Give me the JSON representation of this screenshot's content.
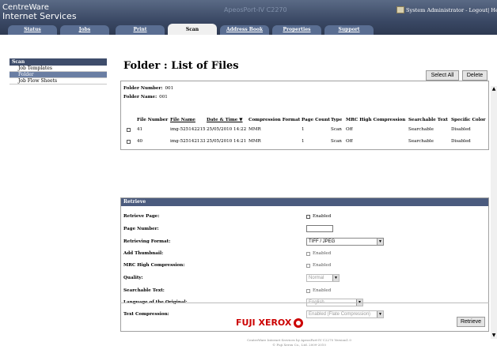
{
  "header": {
    "brand_line1": "CentreWare",
    "brand_line2": "Internet Services",
    "model": "ApeosPort-IV C2270",
    "user_text": "System Administrator - Logout| Help"
  },
  "tabs": [
    {
      "label": "Status"
    },
    {
      "label": "Jobs"
    },
    {
      "label": "Print"
    },
    {
      "label": "Scan"
    },
    {
      "label": "Address Book"
    },
    {
      "label": "Properties"
    },
    {
      "label": "Support"
    }
  ],
  "sidebar": {
    "heading": "Scan",
    "items": [
      {
        "label": "Job Templates"
      },
      {
        "label": "Folder"
      },
      {
        "label": "Job Flow Sheets"
      }
    ]
  },
  "main": {
    "title": "Folder : List of Files",
    "select_all_label": "Select All",
    "delete_label": "Delete",
    "folder_number_label": "Folder Number:",
    "folder_number": "001",
    "folder_name_label": "Folder Name:",
    "folder_name": "001",
    "columns": [
      "File Number",
      "File Name",
      "Date & Time ▼",
      "Compression Format",
      "Page Count",
      "Type",
      "MRC High Compression",
      "Searchable Text",
      "Specific Color"
    ],
    "rows": [
      {
        "file_number": "41",
        "file_name": "img-525142215",
        "datetime": "25/05/2010 14:22",
        "compression": "MMR",
        "page_count": "1",
        "type": "Scan",
        "mrc": "Off",
        "searchable": "Searchable",
        "color": "Disabled"
      },
      {
        "file_number": "40",
        "file_name": "img-525142133",
        "datetime": "25/05/2010 14:21",
        "compression": "MMR",
        "page_count": "1",
        "type": "Scan",
        "mrc": "Off",
        "searchable": "Searchable",
        "color": "Disabled"
      }
    ]
  },
  "retrieve": {
    "heading": "Retrieve",
    "retrieve_page_label": "Retrieve Page:",
    "retrieve_page_value": "Enabled",
    "page_number_label": "Page Number:",
    "retrieving_format_label": "Retrieving Format:",
    "retrieving_format_value": "TIFF / JPEG",
    "add_thumbnail_label": "Add Thumbnail:",
    "add_thumbnail_value": "Enabled",
    "mrc_label": "MRC High Compression:",
    "mrc_value": "Enabled",
    "quality_label": "Quality:",
    "quality_value": "Normal",
    "searchable_label": "Searchable Text:",
    "searchable_value": "Enabled",
    "language_label": "Language of the Original:",
    "language_value": "English",
    "text_compression_label": "Text Compression:",
    "text_compression_value": "Enabled (Flate Compression)",
    "retrieve_button": "Retrieve"
  },
  "footer": {
    "logo_text": "FUJI XEROX",
    "copyright_line1": "CentreWare Internet Services by ApeosPort-IV C2270 Version1.0",
    "copyright_line2": "© Fuji Xerox Co., Ltd. 2009-2010"
  }
}
